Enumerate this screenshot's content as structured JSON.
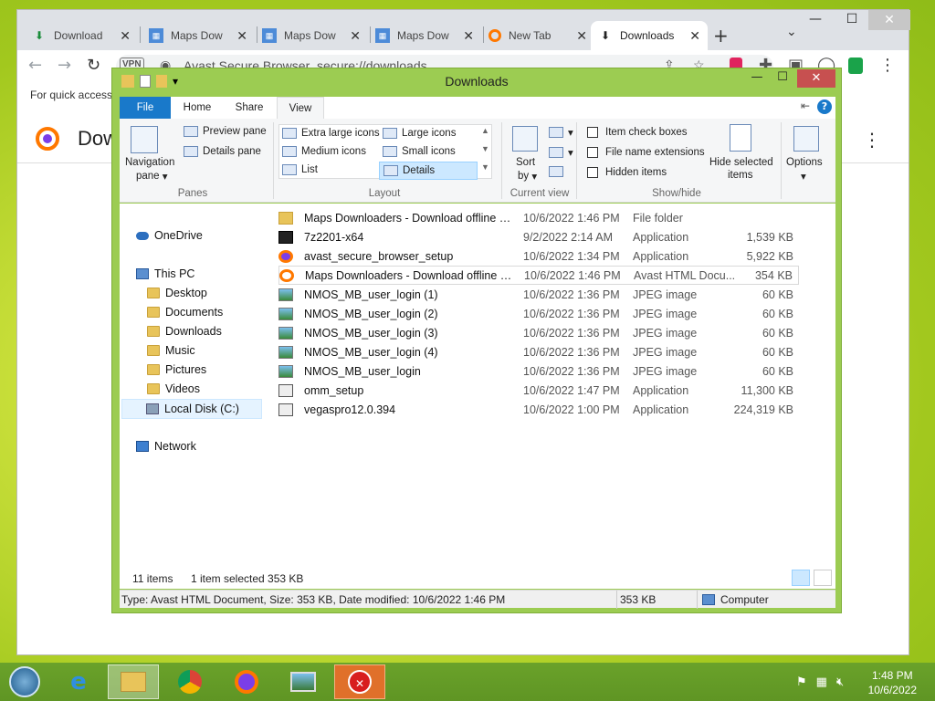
{
  "browser": {
    "tabs": [
      {
        "label": "Download",
        "icon": "download-icon"
      },
      {
        "label": "Maps Dow",
        "icon": "map-icon"
      },
      {
        "label": "Maps Dow",
        "icon": "map-icon"
      },
      {
        "label": "Maps Dow",
        "icon": "map-icon"
      },
      {
        "label": "New Tab",
        "icon": "avast-icon"
      },
      {
        "label": "Downloads",
        "icon": "download-icon"
      }
    ],
    "vpn_label": "VPN",
    "omnibox_site": "Avast Secure Browser",
    "omnibox_url": "secure://downloads",
    "bookmarks_text": "For quick access,",
    "page_title": "Dow"
  },
  "explorer": {
    "title": "Downloads",
    "ribbon_tabs": [
      "File",
      "Home",
      "Share",
      "View"
    ],
    "panes": {
      "navigation_pane": "Navigation",
      "navigation_pane2": "pane",
      "preview_pane": "Preview pane",
      "details_pane": "Details pane",
      "label": "Panes"
    },
    "layout": {
      "items": [
        "Extra large icons",
        "Large icons",
        "Medium icons",
        "Small icons",
        "List",
        "Details"
      ],
      "label": "Layout"
    },
    "current_view": {
      "sort": "Sort",
      "sort2": "by",
      "label": "Current view"
    },
    "show_hide": {
      "item_check_boxes": "Item check boxes",
      "file_name_extensions": "File name extensions",
      "hidden_items": "Hidden items",
      "hide_selected": "Hide selected",
      "hide_selected2": "items",
      "label": "Show/hide"
    },
    "options": "Options",
    "nav": {
      "onedrive": "OneDrive",
      "this_pc": "This PC",
      "desktop": "Desktop",
      "documents": "Documents",
      "downloads": "Downloads",
      "music": "Music",
      "pictures": "Pictures",
      "videos": "Videos",
      "local_disk": "Local Disk (C:)",
      "network": "Network"
    },
    "files": [
      {
        "name": "Maps Downloaders - Download offline m...",
        "date": "10/6/2022 1:46 PM",
        "type": "File folder",
        "size": "",
        "icon": "folder-icon"
      },
      {
        "name": "7z2201-x64",
        "date": "9/2/2022 2:14 AM",
        "type": "Application",
        "size": "1,539 KB",
        "icon": "7zip-icon"
      },
      {
        "name": "avast_secure_browser_setup",
        "date": "10/6/2022 1:34 PM",
        "type": "Application",
        "size": "5,922 KB",
        "icon": "avast-icon"
      },
      {
        "name": "Maps Downloaders - Download offline m...",
        "date": "10/6/2022 1:46 PM",
        "type": "Avast HTML Docu...",
        "size": "354 KB",
        "icon": "avast-html-icon"
      },
      {
        "name": "NMOS_MB_user_login (1)",
        "date": "10/6/2022 1:36 PM",
        "type": "JPEG image",
        "size": "60 KB",
        "icon": "image-icon"
      },
      {
        "name": "NMOS_MB_user_login (2)",
        "date": "10/6/2022 1:36 PM",
        "type": "JPEG image",
        "size": "60 KB",
        "icon": "image-icon"
      },
      {
        "name": "NMOS_MB_user_login (3)",
        "date": "10/6/2022 1:36 PM",
        "type": "JPEG image",
        "size": "60 KB",
        "icon": "image-icon"
      },
      {
        "name": "NMOS_MB_user_login (4)",
        "date": "10/6/2022 1:36 PM",
        "type": "JPEG image",
        "size": "60 KB",
        "icon": "image-icon"
      },
      {
        "name": "NMOS_MB_user_login",
        "date": "10/6/2022 1:36 PM",
        "type": "JPEG image",
        "size": "60 KB",
        "icon": "image-icon"
      },
      {
        "name": "omm_setup",
        "date": "10/6/2022 1:47 PM",
        "type": "Application",
        "size": "11,300 KB",
        "icon": "app-icon"
      },
      {
        "name": "vegaspro12.0.394",
        "date": "10/6/2022 1:00 PM",
        "type": "Application",
        "size": "224,319 KB",
        "icon": "app-icon"
      }
    ],
    "status": {
      "count": "11 items",
      "selected": "1 item selected  353 KB",
      "details": "Type: Avast HTML Document, Size: 353 KB, Date modified: 10/6/2022 1:46 PM",
      "size": "353 KB",
      "computer": "Computer"
    }
  },
  "taskbar": {
    "time": "1:48 PM",
    "date": "10/6/2022"
  },
  "colors": {
    "accent_blue": "#1979ca",
    "window_frame": "#9ccc52",
    "taskbar": "#5f9524",
    "close_red": "#c75050"
  }
}
